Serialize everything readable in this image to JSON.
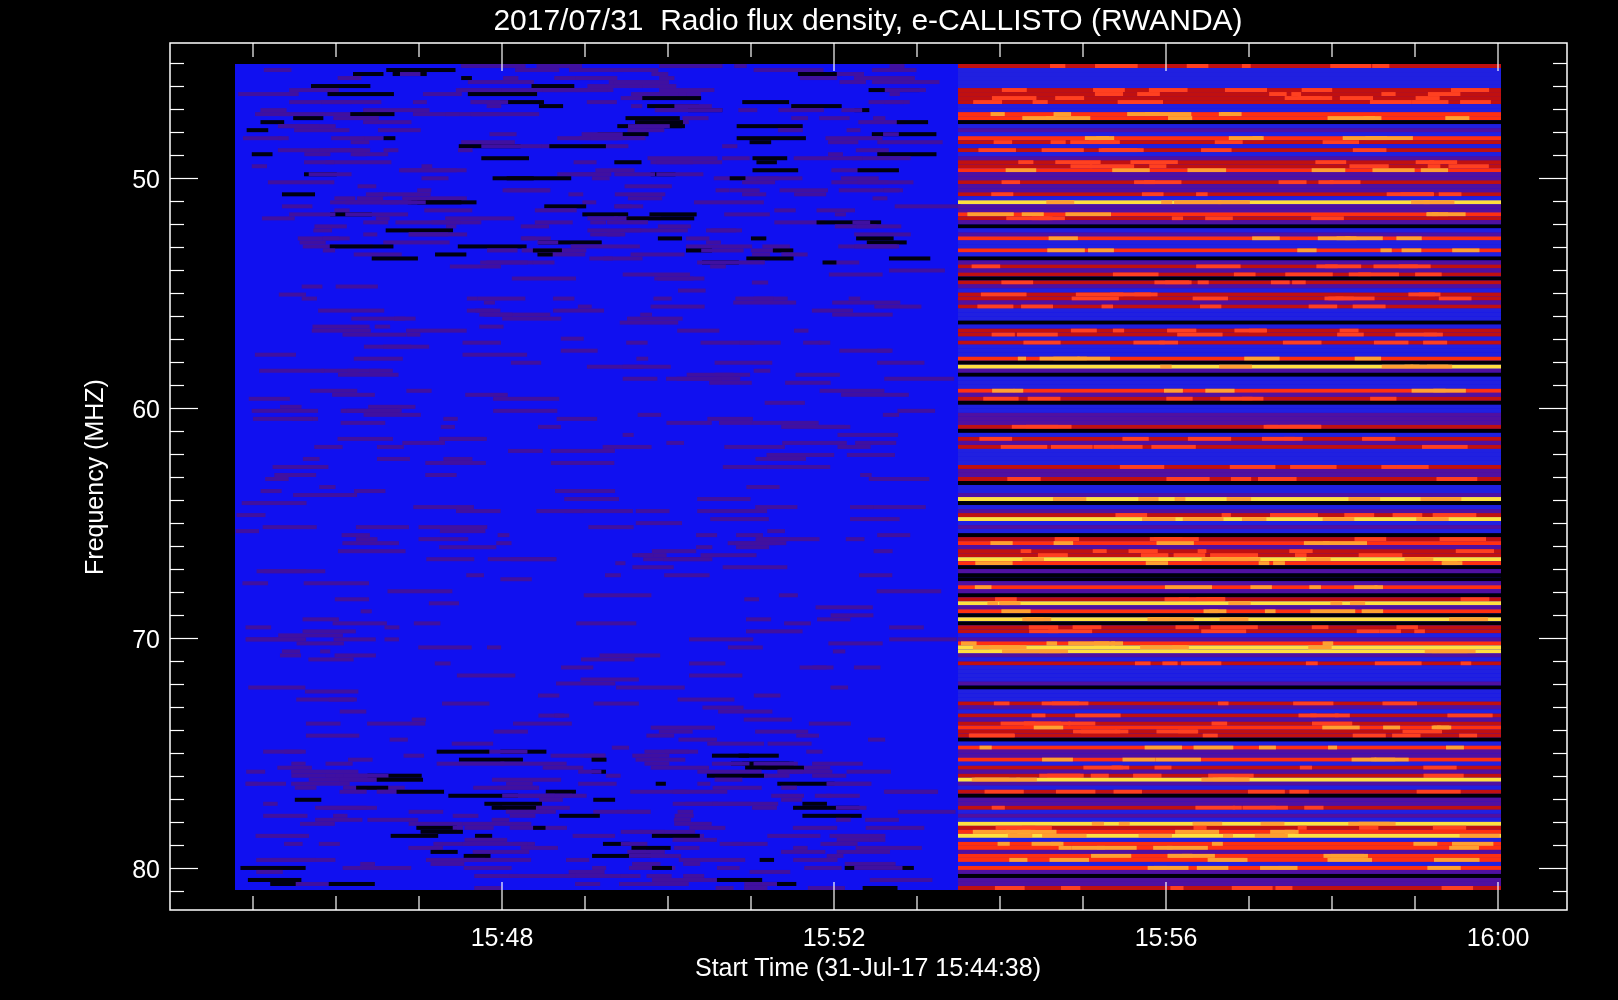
{
  "title": "2017/07/31  Radio flux density, e-CALLISTO (RWANDA)",
  "y_axis": {
    "label": "Frequency (MHZ)",
    "tick_labels": [
      "50",
      "60",
      "70",
      "80"
    ]
  },
  "x_axis": {
    "label": "Start Time (31-Jul-17 15:44:38)",
    "tick_labels": [
      "15:48",
      "15:52",
      "15:56",
      "16:00"
    ]
  }
}
